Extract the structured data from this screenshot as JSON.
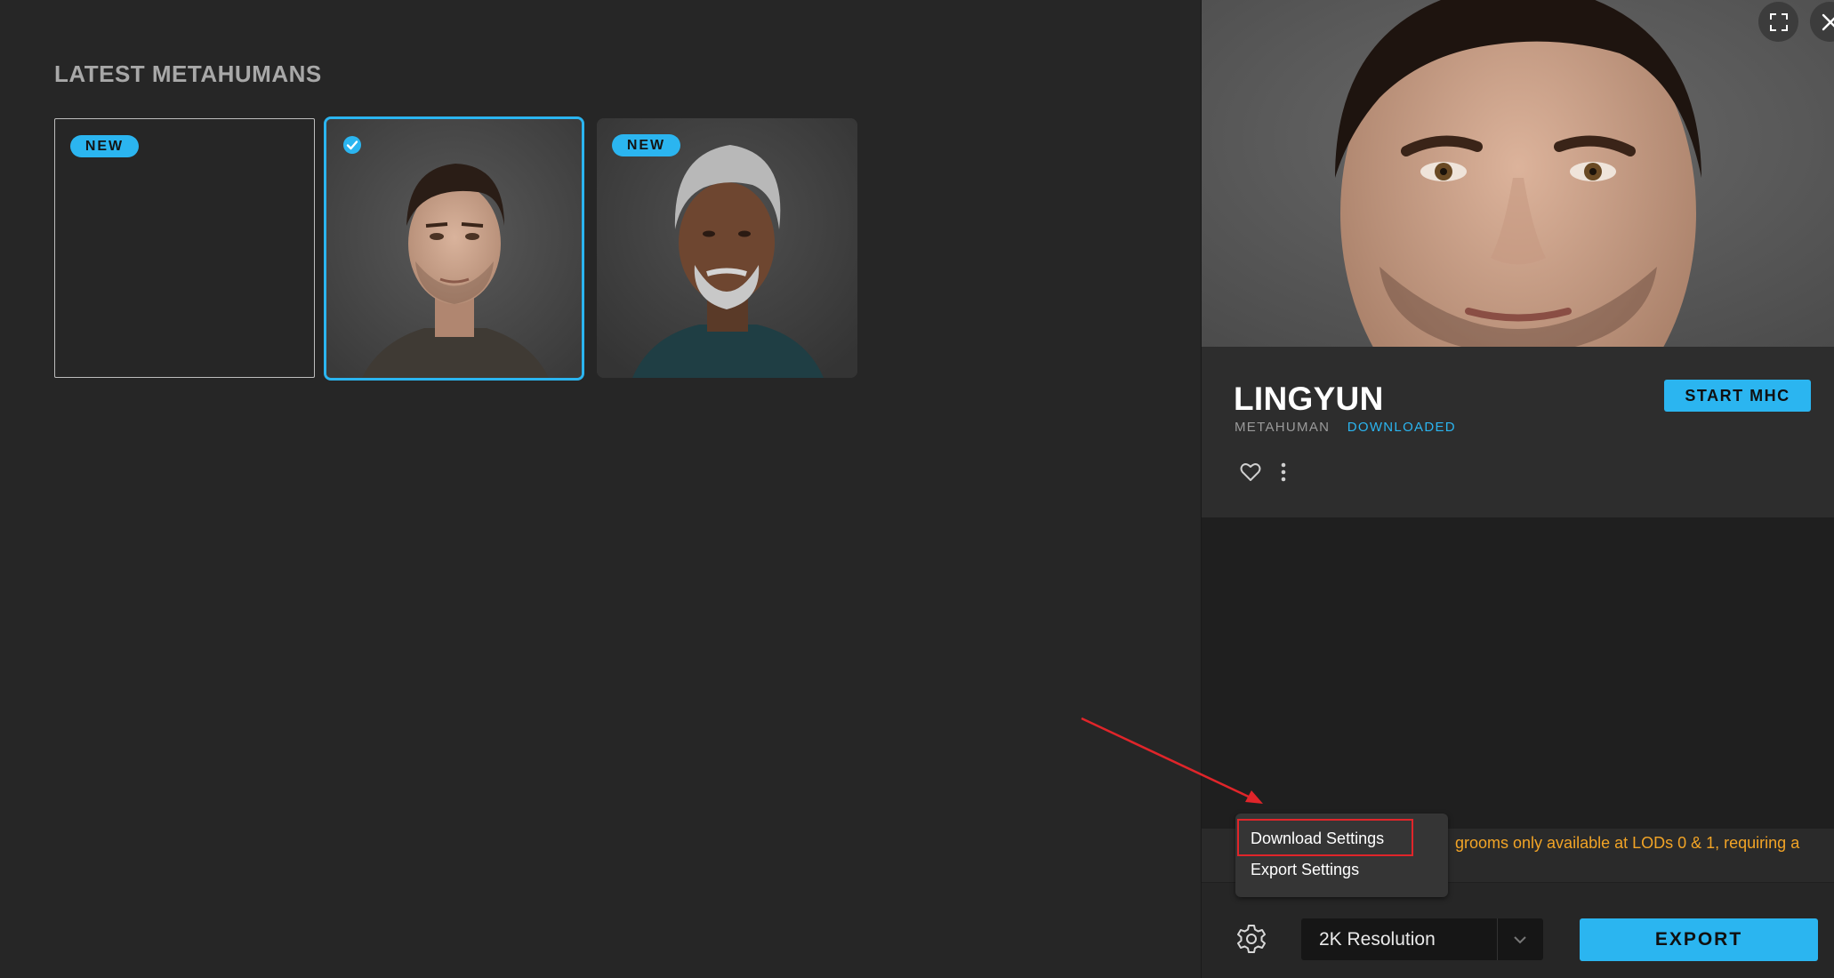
{
  "gallery": {
    "title": "LATEST METAHUMANS",
    "cards": [
      {
        "badge": "NEW",
        "selected": false
      },
      {
        "badge": "",
        "selected": true
      },
      {
        "badge": "NEW",
        "selected": false
      }
    ]
  },
  "panel": {
    "name": "LINGYUN",
    "type_tag": "METAHUMAN",
    "status_tag": "DOWNLOADED",
    "start_button": "START MHC",
    "warning": "grooms only available at LODs 0 & 1, requiring a",
    "resolution": "2K Resolution",
    "export_button": "EXPORT"
  },
  "menu": {
    "items": [
      "Download Settings",
      "Export Settings"
    ]
  },
  "colors": {
    "accent": "#2bb5f0",
    "warning": "#f2a426",
    "annotation": "#e0252a"
  },
  "icons": [
    "check-icon",
    "fullscreen-icon",
    "close-icon",
    "heart-icon",
    "more-vertical-icon",
    "gear-icon",
    "chevron-down-icon"
  ]
}
